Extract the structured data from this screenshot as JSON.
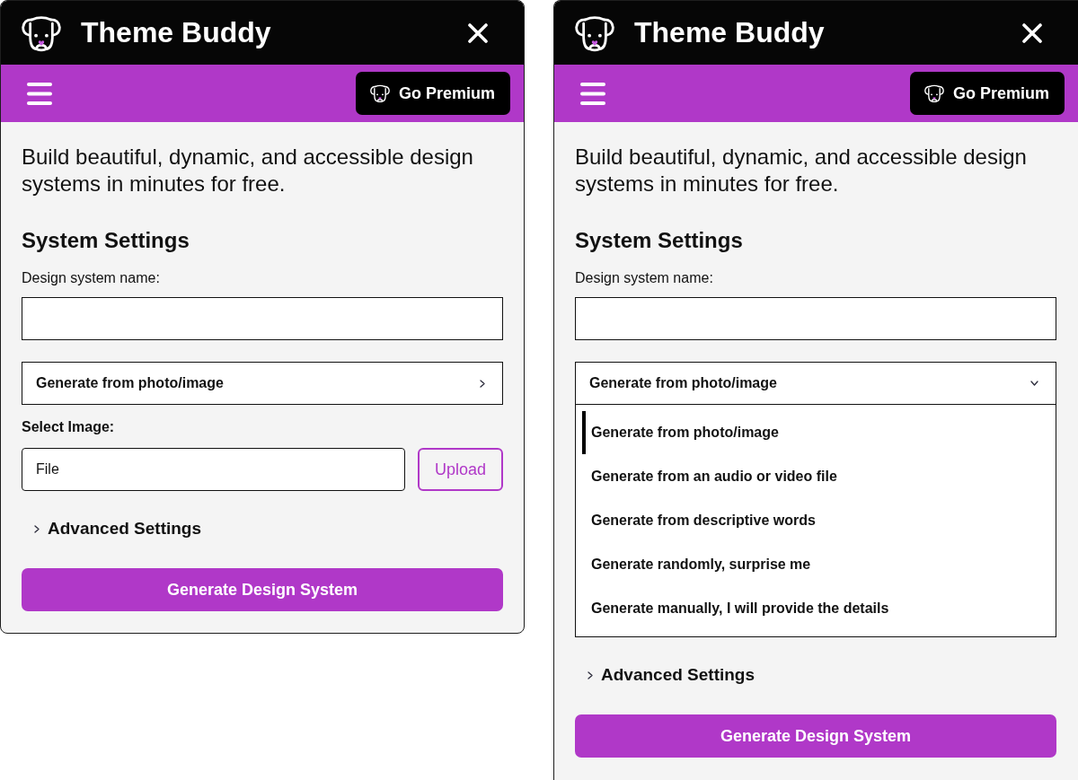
{
  "panels": [
    {
      "title_bar": {
        "title": "Theme Buddy"
      },
      "toolbar": {
        "premium_button": "Go Premium"
      },
      "intro": "Build beautiful, dynamic, and accessible design systems in minutes for free.",
      "section_title": "System Settings",
      "name_field": {
        "label": "Design system name:"
      },
      "source_select": {
        "value": "Generate from photo/image",
        "expanded": false
      },
      "image_field": {
        "label": "Select Image:",
        "value": "File",
        "button": "Upload"
      },
      "advanced": {
        "label": "Advanced Settings",
        "expanded": false
      },
      "generate_button": "Generate Design System"
    },
    {
      "title_bar": {
        "title": "Theme Buddy"
      },
      "toolbar": {
        "premium_button": "Go Premium"
      },
      "intro": "Build beautiful, dynamic, and accessible design systems in minutes for free.",
      "section_title": "System Settings",
      "name_field": {
        "label": "Design system name:"
      },
      "source_select": {
        "value": "Generate from photo/image",
        "expanded": true,
        "options": [
          {
            "label": "Generate from photo/image",
            "selected": true
          },
          {
            "label": "Generate from an audio or video file",
            "selected": false
          },
          {
            "label": "Generate from descriptive words",
            "selected": false
          },
          {
            "label": "Generate randomly, surprise me",
            "selected": false
          },
          {
            "label": "Generate manually, I will provide the details",
            "selected": false
          }
        ]
      },
      "advanced": {
        "label": "Advanced Settings",
        "expanded": false
      },
      "generate_button": "Generate Design System"
    }
  ]
}
